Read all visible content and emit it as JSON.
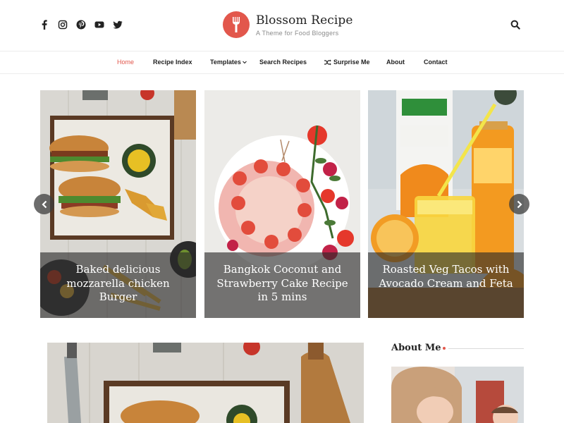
{
  "site": {
    "title": "Blossom Recipe",
    "tagline": "A Theme for Food Bloggers"
  },
  "social_icons": [
    "facebook-icon",
    "instagram-icon",
    "pinterest-icon",
    "youtube-icon",
    "twitter-icon"
  ],
  "nav": {
    "items": [
      {
        "label": "Home",
        "active": true
      },
      {
        "label": "Recipe Index"
      },
      {
        "label": "Templates",
        "has_dropdown": true
      },
      {
        "label": "Search Recipes"
      },
      {
        "label": "Surprise Me",
        "icon": "shuffle-icon"
      },
      {
        "label": "About"
      },
      {
        "label": "Contact"
      }
    ]
  },
  "slider": {
    "slides": [
      {
        "caption": "Baked delicious mozzarella chicken Burger"
      },
      {
        "caption": "Bangkok Coconut and Strawberry Cake Recipe in 5 mins"
      },
      {
        "caption": "Roasted Veg Tacos with Avocado Cream and Feta"
      }
    ],
    "prev_icon": "chevron-left-icon",
    "next_icon": "chevron-right-icon"
  },
  "sidebar": {
    "about_title": "About Me"
  },
  "colors": {
    "accent": "#e2574c",
    "caption_overlay": "#282828"
  }
}
